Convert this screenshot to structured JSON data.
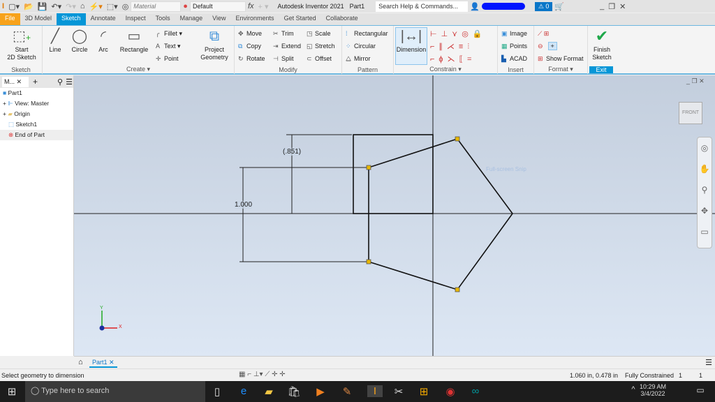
{
  "titlebar": {
    "app_title": "Autodesk Inventor 2021",
    "doc_name": "Part1",
    "search_placeholder": "Search Help & Commands...",
    "material": "Material",
    "appearance": "Default",
    "alert_count": "0"
  },
  "tabs": [
    "File",
    "3D Model",
    "Sketch",
    "Annotate",
    "Inspect",
    "Tools",
    "Manage",
    "View",
    "Environments",
    "Get Started",
    "Collaborate"
  ],
  "active_tab": "Sketch",
  "ribbon": {
    "sketch": {
      "label": "Sketch",
      "start": "Start\n2D Sketch"
    },
    "create": {
      "label": "Create",
      "line": "Line",
      "circle": "Circle",
      "arc": "Arc",
      "rectangle": "Rectangle",
      "fillet": "Fillet",
      "text": "Text",
      "point": "Point",
      "project": "Project Geometry"
    },
    "modify": {
      "label": "Modify",
      "move": "Move",
      "copy": "Copy",
      "rotate": "Rotate",
      "trim": "Trim",
      "extend": "Extend",
      "split": "Split",
      "scale": "Scale",
      "stretch": "Stretch",
      "offset": "Offset"
    },
    "pattern": {
      "label": "Pattern",
      "rectangular": "Rectangular",
      "circular": "Circular",
      "mirror": "Mirror"
    },
    "constrain": {
      "label": "Constrain",
      "dimension": "Dimension"
    },
    "insert": {
      "label": "Insert",
      "image": "Image",
      "points": "Points",
      "acad": "ACAD"
    },
    "format": {
      "label": "Format",
      "show_format": "Show Format"
    },
    "exit": {
      "label": "Exit",
      "finish": "Finish Sketch"
    }
  },
  "browser": {
    "tab": "M...",
    "items": [
      "Part1",
      "View: Master",
      "Origin",
      "Sketch1",
      "End of Part"
    ]
  },
  "canvas": {
    "dims": [
      "(.851)",
      "1.000"
    ],
    "viewcube": "FRONT",
    "watermark": "Full-screen Snip",
    "axis_x": "X",
    "axis_y": "Y"
  },
  "doctabs": {
    "tab": "Part1"
  },
  "status": {
    "message": "Select geometry to dimension",
    "coords": "1.060 in, 0.478 in",
    "constraint": "Fully Constrained",
    "count1": "1",
    "count2": "1"
  },
  "taskbar": {
    "search_placeholder": "Type here to search",
    "time": "10:29 AM",
    "date": "3/4/2022"
  },
  "colors": {
    "accent": "#0696d7",
    "file": "#f7a21b",
    "point": "#e8b800"
  }
}
